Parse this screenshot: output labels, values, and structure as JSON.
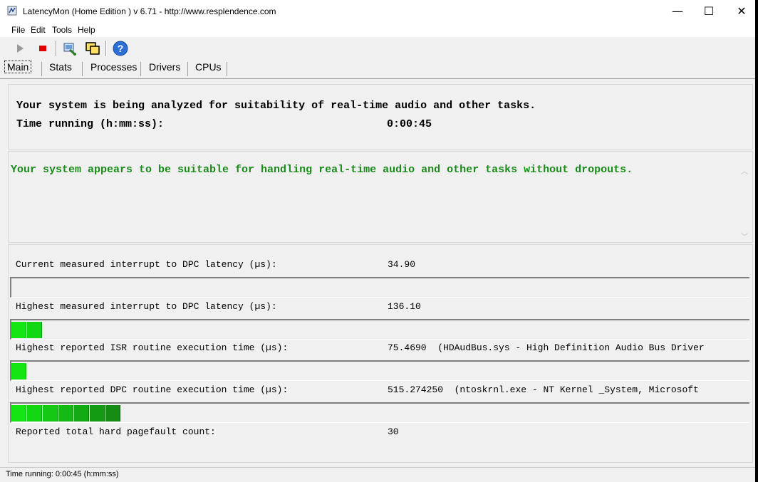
{
  "window": {
    "title": "LatencyMon  (Home Edition )  v 6.71 - http://www.resplendence.com",
    "minimize": "—",
    "maximize": "☐",
    "close": "✕"
  },
  "menu": {
    "file": "File",
    "edit": "Edit",
    "tools": "Tools",
    "help": "Help"
  },
  "toolbar": {
    "play_icon": "play-icon",
    "stop_icon": "stop-icon",
    "stop_color": "#e00000",
    "settings_icon": "cpu-settings-icon",
    "window_icon": "window-icon",
    "help_icon": "help-icon"
  },
  "tabs": [
    "Main",
    "Stats",
    "Processes",
    "Drivers",
    "CPUs"
  ],
  "summary": {
    "line1": "Your system is being analyzed for suitability of real-time audio and other tasks.",
    "time_label": "Time running (h:mm:ss):",
    "time_value": "0:00:45"
  },
  "verdict": {
    "text": "Your system appears to be suitable for handling real-time audio and other tasks without dropouts.",
    "color": "#1a8a1a"
  },
  "metrics": [
    {
      "label": "Current measured interrupt to DPC latency (µs):",
      "value": "34.90",
      "detail": "",
      "bar_segments": 0
    },
    {
      "label": "Highest measured interrupt to DPC latency (µs):",
      "value": "136.10",
      "detail": "",
      "bar_segments": 2
    },
    {
      "label": "Highest reported ISR routine execution time (µs):",
      "value": "75.4690",
      "detail": "(HDAudBus.sys - High Definition Audio Bus Driver",
      "bar_segments": 1
    },
    {
      "label": "Highest reported DPC routine execution time (µs):",
      "value": "515.274250",
      "detail": "(ntoskrnl.exe - NT Kernel _System, Microsoft",
      "bar_segments": 7
    },
    {
      "label": "Reported total hard pagefault count:",
      "value": "30",
      "detail": ""
    }
  ],
  "status": {
    "text": "Time running: 0:00:45  (h:mm:ss)"
  }
}
